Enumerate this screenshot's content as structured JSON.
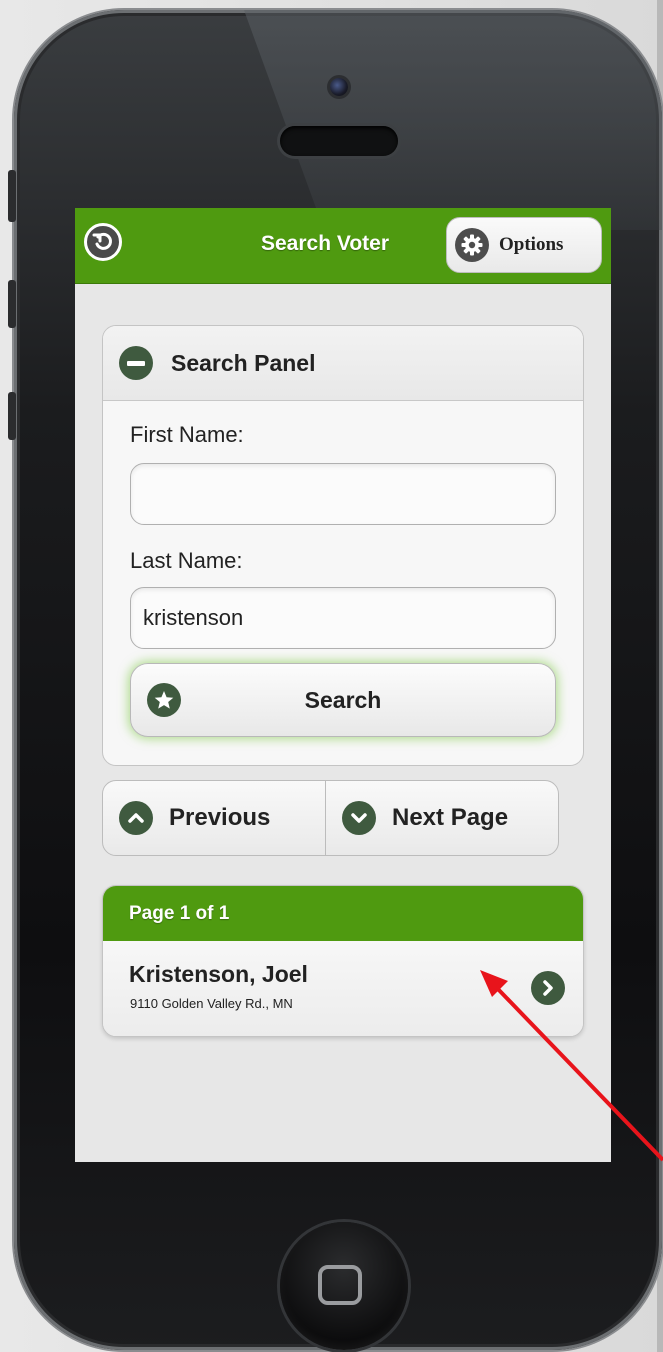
{
  "header": {
    "title": "Search Voter",
    "options_label": "Options"
  },
  "search_panel": {
    "title": "Search Panel",
    "first_name_label": "First Name:",
    "first_name_value": "",
    "last_name_label": "Last Name:",
    "last_name_value": "kristenson",
    "search_label": "Search"
  },
  "pager": {
    "previous_label": "Previous",
    "next_label": "Next Page"
  },
  "results": {
    "page_label": "Page 1 of 1",
    "items": [
      {
        "name": "Kristenson, Joel",
        "address": "9110 Golden Valley Rd., MN"
      }
    ]
  },
  "colors": {
    "header_green": "#4f9a10",
    "icon_dark_green": "#3f5a3f",
    "annotation_red": "#e8141b"
  },
  "icons": {
    "back": "back-icon",
    "options": "gear-icon",
    "panel_toggle": "minus-icon",
    "search": "star-icon",
    "previous": "chevron-up-icon",
    "next": "chevron-down-icon",
    "result": "chevron-right-icon"
  }
}
